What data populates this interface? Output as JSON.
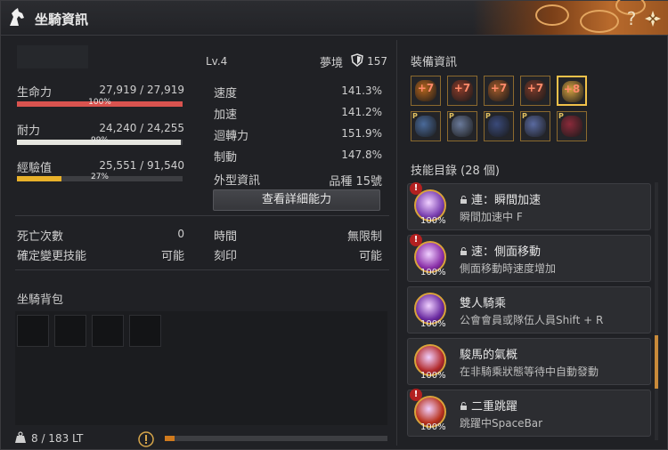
{
  "window": {
    "title": "坐騎資訊"
  },
  "mount": {
    "level": "Lv.4",
    "region": "夢境",
    "gear_score": "157",
    "stats": {
      "hp": {
        "label": "生命力",
        "value": "27,919 / 27,919",
        "pct_label": "100%",
        "fraction": 1.0,
        "color": "#d9534f"
      },
      "stamina": {
        "label": "耐力",
        "value": "24,240 / 24,255",
        "pct_label": "99%",
        "fraction": 0.99,
        "color": "#e6e6e0"
      },
      "exp": {
        "label": "經驗值",
        "value": "25,551 / 91,540",
        "pct_label": "27%",
        "fraction": 0.27,
        "color": "#e8b12a"
      }
    },
    "attrs": [
      {
        "label": "速度",
        "value": "141.3%"
      },
      {
        "label": "加速",
        "value": "141.2%"
      },
      {
        "label": "迴轉力",
        "value": "151.9%"
      },
      {
        "label": "制動",
        "value": "147.8%"
      },
      {
        "label": "外型資訊",
        "value": "品種 15號"
      }
    ],
    "detail_button": "查看詳細能力",
    "death_label": "死亡次數",
    "death_value": "0",
    "time_label": "時間",
    "time_value": "無限制",
    "skill_change_label": "確定變更技能",
    "skill_change_value": "可能",
    "imprint_label": "刻印",
    "imprint_value": "可能"
  },
  "pack": {
    "title": "坐騎背包",
    "weight": "8 / 183 LT",
    "progress_fraction": 0.045
  },
  "equipment": {
    "title": "裝備資訊",
    "row1": [
      "+7",
      "+7",
      "+7",
      "+7",
      "+8"
    ],
    "row2": [
      "P",
      "P",
      "P",
      "P",
      "P"
    ],
    "icons_row1": [
      "barding-icon",
      "saddle-icon",
      "stirrups-icon",
      "horseshoe-icon",
      "ring-icon"
    ],
    "icons_row2": [
      "horse-armor-icon",
      "horse-saddle-icon",
      "horse-stirrup-icon",
      "horse-shoe-icon",
      "horse-costume-icon"
    ]
  },
  "skills": {
    "title": "技能目錄 (28 個)",
    "items": [
      {
        "name": "連：瞬間加速",
        "desc": "瞬間加速中 F",
        "pct": "100%",
        "locked": true,
        "warn": true,
        "color": "#7a3fb0"
      },
      {
        "name": "速：側面移動",
        "desc": "側面移動時速度增加",
        "pct": "100%",
        "locked": true,
        "warn": true,
        "color": "#8a2fa8"
      },
      {
        "name": "雙人騎乘",
        "desc": "公會會員或隊伍人員Shift + R",
        "pct": "100%",
        "locked": false,
        "warn": false,
        "color": "#6a2aa0"
      },
      {
        "name": "駿馬的氣概",
        "desc": "在非騎乘狀態等待中自動發動",
        "pct": "100%",
        "locked": false,
        "warn": false,
        "color": "#b22a2a"
      },
      {
        "name": "二重跳躍",
        "desc": "跳躍中SpaceBar",
        "pct": "100%",
        "locked": true,
        "warn": true,
        "color": "#b8321c"
      }
    ]
  }
}
